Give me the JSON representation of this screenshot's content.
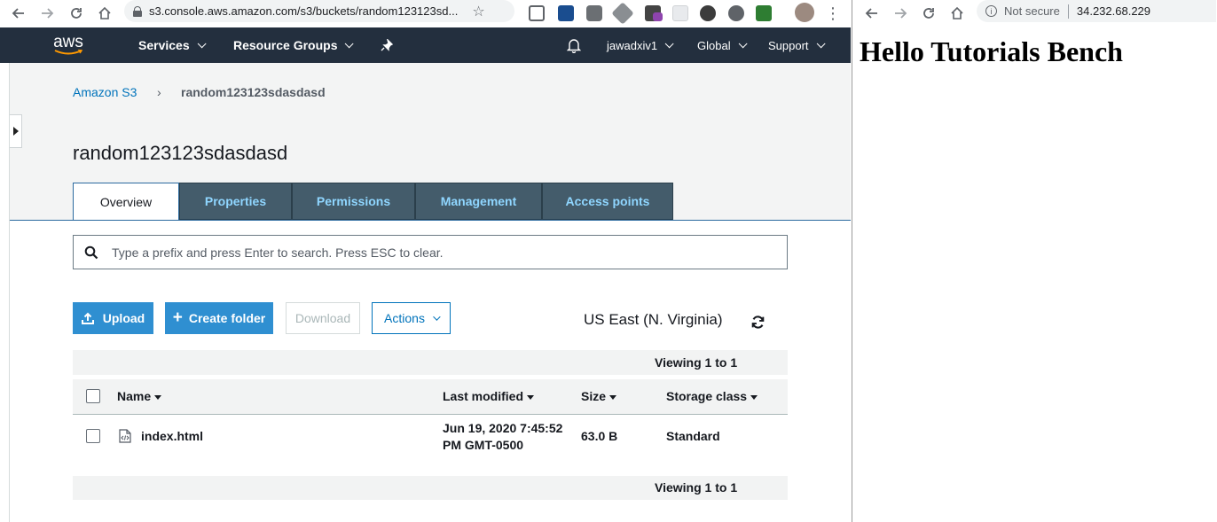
{
  "left_browser": {
    "url": "s3.console.aws.amazon.com/s3/buckets/random123123sd..."
  },
  "aws_nav": {
    "logo": "aws",
    "services": "Services",
    "resource_groups": "Resource Groups",
    "account": "jawadxiv1",
    "region": "Global",
    "support": "Support"
  },
  "breadcrumb": {
    "root": "Amazon S3",
    "separator": "›",
    "current": "random123123sdasdasd"
  },
  "bucket_title": "random123123sdasdasd",
  "tabs": [
    {
      "label": "Overview"
    },
    {
      "label": "Properties"
    },
    {
      "label": "Permissions"
    },
    {
      "label": "Management"
    },
    {
      "label": "Access points"
    }
  ],
  "search": {
    "placeholder": "Type a prefix and press Enter to search. Press ESC to clear."
  },
  "toolbar": {
    "upload": "Upload",
    "create_folder": "Create folder",
    "download": "Download",
    "actions": "Actions",
    "region": "US East (N. Virginia)"
  },
  "table": {
    "viewing_top": "Viewing 1 to 1",
    "viewing_bottom": "Viewing 1 to 1",
    "headers": {
      "name": "Name",
      "last_modified": "Last modified",
      "size": "Size",
      "storage_class": "Storage class"
    },
    "rows": [
      {
        "name": "index.html",
        "last_modified_line1": "Jun 19, 2020 7:45:52",
        "last_modified_line2": "PM GMT-0500",
        "size": "63.0 B",
        "storage_class": "Standard"
      }
    ]
  },
  "right_browser": {
    "security": "Not secure",
    "url": "34.232.68.229",
    "heading": "Hello Tutorials Bench"
  },
  "colors": {
    "aws_nav_bg": "#232f3e",
    "aws_orange": "#ff9900",
    "link_blue": "#0073bb",
    "primary_button": "#2f8fd1",
    "tab_bg": "#445c6b",
    "tab_text": "#8fd6ff"
  }
}
